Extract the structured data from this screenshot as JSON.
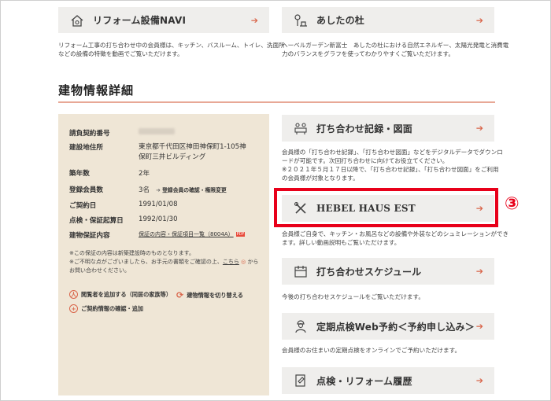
{
  "top_cards": {
    "reform": {
      "label": "リフォーム設備NAVI",
      "desc1": "リフォーム工事の打ち合わせ中の会員様は、キッチン、バスルーム、トイレ、洗面所",
      "desc2": "などの設備の特徴を動画でご覧いただけます。"
    },
    "ashita": {
      "label": "あしたの杜",
      "desc1": "ヘーベルガーデン新富士　あしたの杜における自然エネルギー、太陽光発電と消費電",
      "desc2": "力のバランスをグラフを使ってわかりやすくご覧いただけます。"
    }
  },
  "section": {
    "title": "建物情報詳細"
  },
  "info": {
    "rows": [
      {
        "k": "請負契約番号",
        "v": ""
      },
      {
        "k": "建設地住所",
        "v": "東京都千代田区神田神保町1-105神",
        "v2": "保町三井ビルディング"
      },
      {
        "k": "築年数",
        "v": "2年"
      },
      {
        "k": "登録会員数",
        "v": "3名",
        "link": "登録会員の確認・権限変更"
      },
      {
        "k": "ご契約日",
        "v": "1991/01/08"
      },
      {
        "k": "点検・保証起算日",
        "v": "1992/01/30"
      },
      {
        "k": "建物保証内容",
        "v": "保証の内容・保証項目一覧（8004A）",
        "pdf": "PDF"
      }
    ],
    "note1": "※この保証の内容は新築建設時のものとなります。",
    "note2a": "※ご不明な点がございましたら、お手元の書類をご確認の上、",
    "note2_link": "こちら",
    "note2b": "から",
    "note3": "お問い合わせください。",
    "actions": {
      "add_family": "閲覧者を追加する（同居の家族等）",
      "switch": "建物情報を切り替える",
      "contract": "ご契約情報の確認・追加"
    }
  },
  "right_cards": {
    "meeting_record": {
      "label": "打ち合わせ記録・図面",
      "desc1": "会員様の「打ち合わせ記録」、「打ち合わせ図面」などをデジタルデータでダウンロ",
      "desc2": "ードが可能です。次回打ち合わせに向けてお役立てください。",
      "desc3": "※２０２１年５月１７日以降で、「打ち合わせ記録」、「打ち合わせ図面」をご利用",
      "desc4": "の会員様が対象となります。"
    },
    "hebel": {
      "label": "HEBEL HAUS EST",
      "desc1": "会員様ご自身で、キッチン・お風呂などの設備や外装などのシュミレーションができ",
      "desc2": "ます。詳しい動画説明もご覧いただけます。"
    },
    "schedule": {
      "label": "打ち合わせスケジュール",
      "desc1": "今後の打ち合わせスケジュールをご覧いただけます。"
    },
    "inspection": {
      "label": "定期点検Web予約＜予約申し込み＞",
      "desc1": "会員様のお住まいの定期点検をオンラインでご予約いただけます。"
    },
    "history": {
      "label": "点検・リフォーム履歴"
    }
  },
  "annotation": {
    "badge": "③"
  },
  "colors": {
    "accent": "#d9654a",
    "highlight": "#e8001a",
    "card_bg": "#efeeec",
    "info_bg": "#efe6d6"
  }
}
